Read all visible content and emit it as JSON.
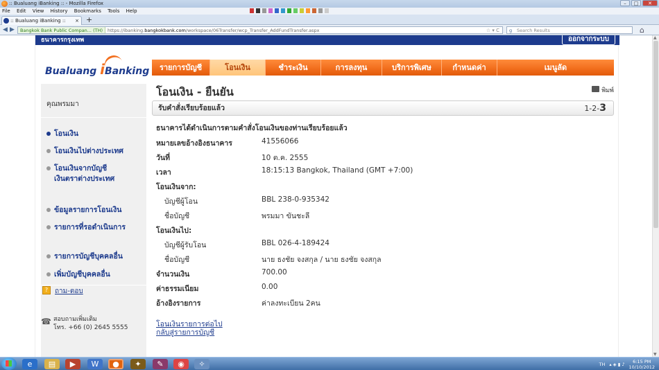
{
  "browser": {
    "window_title": ":: Bualuang iBanking :: - Mozilla Firefox",
    "menu": [
      "File",
      "Edit",
      "View",
      "History",
      "Bookmarks",
      "Tools",
      "Help"
    ],
    "tab_title": ":: Bualuang iBanking ::",
    "new_tab": "+",
    "identity": "Bangkok Bank Public Compan... (TH)",
    "url_prefix": "https://ibanking.",
    "url_domain": "bangkokbank.com",
    "url_path": "/workspace/06Transfer/wcp_Transfer_AddFundTransfer.aspx",
    "search_placeholder": "Search Results"
  },
  "header": {
    "bank_name": "ธนาคารกรุงเทพ",
    "logout_label": "ออกจากระบบ",
    "logo_text_1": "Bualuang",
    "logo_text_2": "i",
    "logo_text_3": "Banking"
  },
  "nav": [
    {
      "label": "รายการบัญชี"
    },
    {
      "label": "โอนเงิน"
    },
    {
      "label": "ชำระเงิน"
    },
    {
      "label": "การลงทุน"
    },
    {
      "label": "บริการพิเศษ"
    },
    {
      "label": "กำหนดค่า"
    },
    {
      "label": "เมนูลัด"
    }
  ],
  "sidebar": {
    "greeting": "คุณพรมมา",
    "items": [
      {
        "label": "โอนเงิน"
      },
      {
        "label": "โอนเงินไปต่างประเทศ"
      },
      {
        "label_1": "โอนเงินจากบัญชี",
        "label_2": "เงินตราต่างประเทศ"
      },
      {
        "label": "ข้อมูลรายการโอนเงิน"
      },
      {
        "label": "รายการที่รอดำเนินการ"
      },
      {
        "label": "รายการบัญชีบุคคลอื่น"
      },
      {
        "label": "เพิ่มบัญชีบุคคลอื่น"
      }
    ],
    "faq": "ถาม-ตอบ",
    "contact_1": "สอบถามเพิ่มเติม",
    "contact_2": "โทร. +66 (0) 2645 5555"
  },
  "main": {
    "title": "โอนเงิน - ยืนยัน",
    "print": "พิมพ์",
    "status": "รับคำสั่งเรียบร้อยแล้ว",
    "steps_prefix": "1-2-",
    "steps_current": "3",
    "notice": "ธนาคารได้ดำเนินการตามคำสั่งโอนเงินของท่านเรียบร้อยแล้ว",
    "rows": [
      {
        "label": "หมายเลขอ้างอิงธนาคาร",
        "value": "41556066"
      },
      {
        "label": "วันที่",
        "value": "10 ต.ค. 2555"
      },
      {
        "label": "เวลา",
        "value": "18:15:13 Bangkok, Thailand (GMT +7:00)"
      },
      {
        "label": "โอนเงินจาก:",
        "value": ""
      },
      {
        "label": "บัญชีผู้โอน",
        "value": "BBL 238-0-935342"
      },
      {
        "label": "ชื่อบัญชี",
        "value": "พรมมา ขันชะลี"
      },
      {
        "label": "โอนเงินไป:",
        "value": ""
      },
      {
        "label": "บัญชีผู้รับโอน",
        "value": "BBL 026-4-189424"
      },
      {
        "label": "ชื่อบัญชี",
        "value": "นาย ธงชัย จงสกุล / นาย ธงชัย จงสกุล"
      },
      {
        "label": "จำนวนเงิน",
        "value": "700.00"
      },
      {
        "label": "ค่าธรรมเนียม",
        "value": "0.00"
      },
      {
        "label": "อ้างอิงรายการ",
        "value": "ค่าลงทะเบียน 2คน"
      }
    ],
    "link_next": "โอนเงินรายการต่อไป",
    "link_back": "กลับสู่รายการบัญชี"
  },
  "taskbar": {
    "lang": "TH",
    "time": "6:15 PM",
    "date": "10/10/2012"
  },
  "colors": {
    "brand_blue": "#1d3b8d",
    "brand_orange": "#f26f1e"
  }
}
